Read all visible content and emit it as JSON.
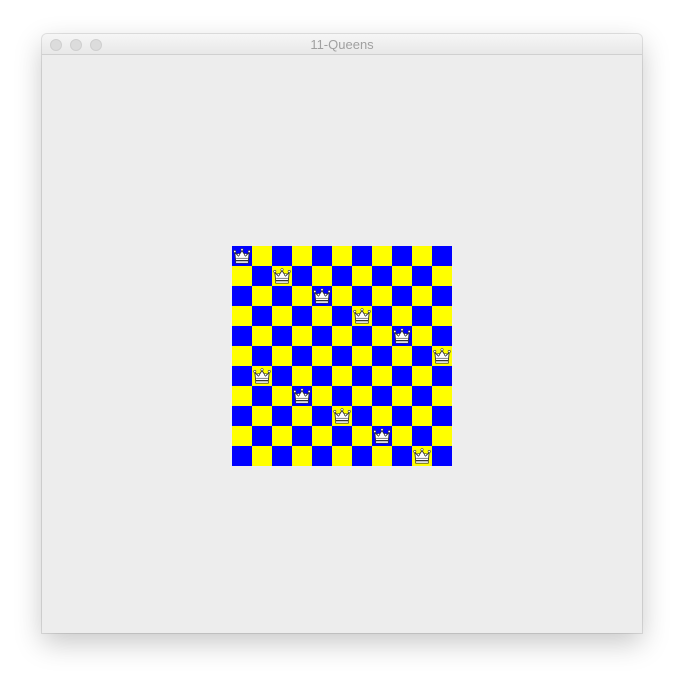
{
  "window": {
    "title": "11-Queens"
  },
  "board": {
    "size": 11,
    "colors": {
      "dark": "#0000ff",
      "light": "#ffff00",
      "queen_fill": "#ffffff",
      "queen_outline": "#333333"
    },
    "queen_icon": "crown-icon",
    "queen_columns": [
      0,
      2,
      4,
      6,
      8,
      10,
      1,
      3,
      5,
      7,
      9
    ]
  }
}
